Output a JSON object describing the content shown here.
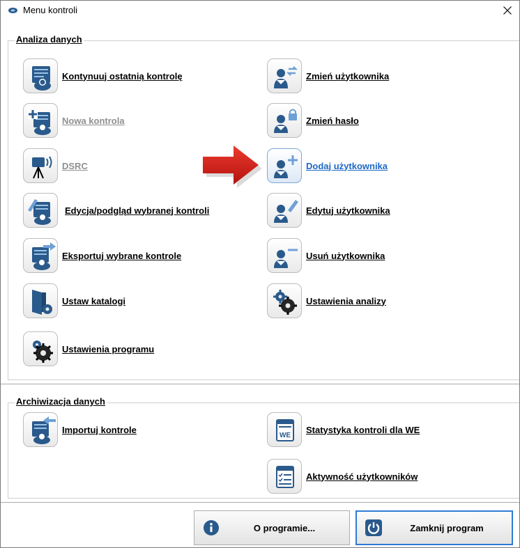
{
  "window": {
    "title": "Menu kontroli"
  },
  "sections": {
    "analysis": {
      "title": "Analiza danych"
    },
    "archive": {
      "title": "Archiwizacja danych"
    }
  },
  "analysis_left": [
    {
      "label": "Kontynuuj ostatnią kontrolę",
      "icon": "document-person-icon",
      "state": "enabled"
    },
    {
      "label": "Nowa kontrola",
      "icon": "new-document-icon",
      "state": "disabled"
    },
    {
      "label": "DSRC",
      "icon": "dsrc-device-icon",
      "state": "disabled"
    },
    {
      "label": "Edycja/podgląd wybranej kontroli",
      "icon": "edit-document-icon",
      "state": "enabled"
    },
    {
      "label": "Eksportuj wybrane kontrole",
      "icon": "export-icon",
      "state": "enabled"
    },
    {
      "label": "Ustaw katalogi",
      "icon": "folder-settings-icon",
      "state": "enabled"
    },
    {
      "label": "Ustawienia programu",
      "icon": "gear-icon",
      "state": "enabled"
    }
  ],
  "analysis_right": [
    {
      "label": "Zmień użytkownika",
      "icon": "switch-user-icon",
      "state": "enabled"
    },
    {
      "label": "Zmień hasło",
      "icon": "user-lock-icon",
      "state": "enabled"
    },
    {
      "label": "Dodaj użytkownika",
      "icon": "add-user-icon",
      "state": "hover"
    },
    {
      "label": "Edytuj użytkownika",
      "icon": "edit-user-icon",
      "state": "enabled"
    },
    {
      "label": "Usuń użytkownika",
      "icon": "remove-user-icon",
      "state": "enabled"
    },
    {
      "label": "Ustawienia analizy",
      "icon": "gears-icon",
      "state": "enabled"
    }
  ],
  "archive_left": [
    {
      "label": "Importuj kontrole",
      "icon": "import-icon",
      "state": "enabled"
    }
  ],
  "archive_right": [
    {
      "label": "Statystyka kontroli dla WE",
      "icon": "we-statistics-icon",
      "state": "enabled"
    },
    {
      "label": "Aktywność użytkowników",
      "icon": "checklist-icon",
      "state": "enabled"
    }
  ],
  "buttons": {
    "about": {
      "label": "O programie...",
      "icon": "info-icon"
    },
    "close": {
      "label": "Zamknij program",
      "icon": "power-icon"
    }
  },
  "colors": {
    "icon_blue": "#2a5a8c",
    "link_hover": "#1d68c5",
    "disabled_text": "#8f8f8f",
    "arrow_red": "#d9201f"
  }
}
